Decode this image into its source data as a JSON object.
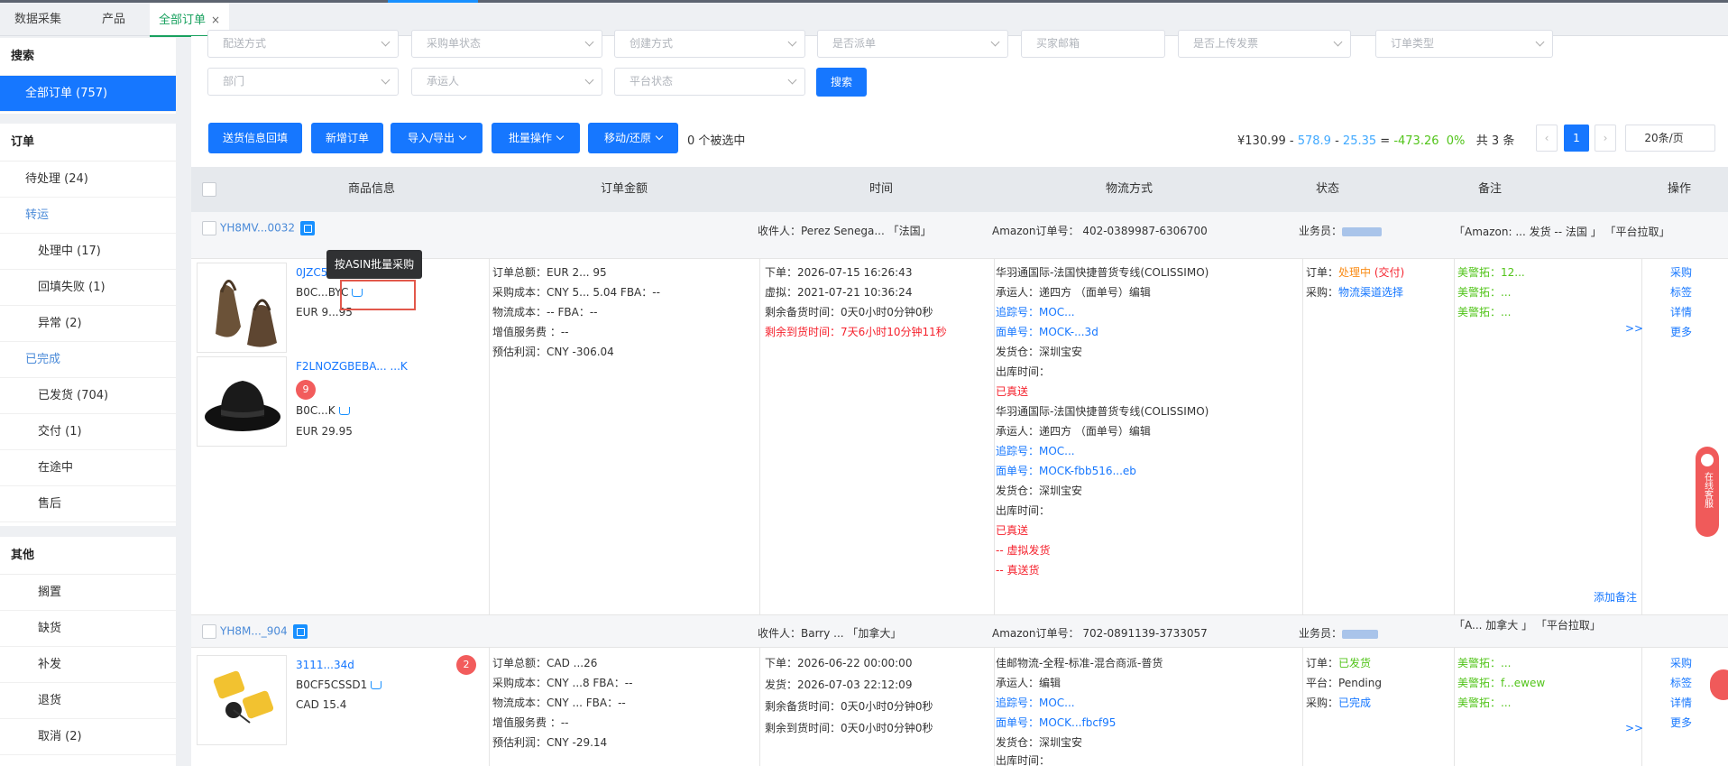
{
  "tabs": [
    "数据采集",
    "产品",
    "全部订单"
  ],
  "sidebar": {
    "search_header": "搜索",
    "all_orders": "全部订单 (757)",
    "order_header": "订单",
    "order_items": [
      "待处理 (24)",
      "转运",
      "处理中 (17)",
      "回填失败 (1)",
      "异常 (2)",
      "已完成",
      "已发货 (704)",
      "交付 (1)",
      "在途中",
      "售后"
    ],
    "other_header": "其他",
    "other_items": [
      "搁置",
      "缺货",
      "补发",
      "退货",
      "取消 (2)"
    ]
  },
  "filters": {
    "row1": [
      "配送方式",
      "采购单状态",
      "创建方式",
      "是否派单",
      "买家邮箱",
      "是否上传发票",
      "订单类型"
    ],
    "row2": [
      "部门",
      "承运人",
      "平台状态"
    ],
    "search_btn": "搜索"
  },
  "toolbar": {
    "buttons": [
      "送货信息回填",
      "新增订单",
      "导入/导出",
      "批量操作",
      "移动/还原"
    ],
    "selected": "0 个被选中"
  },
  "summary": {
    "total": "¥130.99",
    "minus1": "578.9",
    "minus2": "25.35",
    "result": "-473.26",
    "pct": "0%",
    "count": "共 3 条"
  },
  "pagination": {
    "page": "1",
    "size": "20条/页"
  },
  "columns": [
    "商品信息",
    "订单金额",
    "时间",
    "物流方式",
    "状态",
    "备注",
    "操作"
  ],
  "orders": [
    {
      "no": "YH8MV...0032",
      "recipient": "收件人：Perez Senega... 「法国」",
      "amazon_no": "Amazon订单号： 402-0389987-6306700",
      "salesman": "业务员：",
      "remark": "「Amazon: ... 发货 -- 法国 」 「平台拉取」",
      "products": [
        {
          "title": "0JZC5...",
          "sku": "B0C...BYC",
          "price": "EUR 9...95"
        },
        {
          "title": "F2LNOZGBEBA... ...K",
          "sku": "B0C...K",
          "price": "EUR 29.95",
          "badge": "9"
        }
      ],
      "amount": [
        "订单总额：EUR 2... 95",
        "采购成本：CNY 5... 5.04   FBA：--",
        "物流成本：--   FBA：--",
        "增值服务费 ：--",
        "预估利润：CNY -306.04"
      ],
      "times": [
        "下单：2026-07-15 16:26:43",
        "虚拟：2021-07-21 10:36:24",
        "剩余备货时间：0天0小时0分钟0秒",
        "剩余到货时间：7天6小时10分钟11秒"
      ],
      "logistics": [
        "华羽通国际-法国快捷普货专线(COLISSIMO)",
        "承运人：递四方 （面单号）编辑",
        "追踪号：MOC...",
        "面单号：MOCK-...3d",
        "发货仓：深圳宝安",
        "出库时间：",
        "已真送",
        "华羽通国际-法国快捷普货专线(COLISSIMO)",
        "承运人：递四方 （面单号）编辑",
        "追踪号：MOC...",
        "面单号：MOCK-fbb516...eb",
        "发货仓：深圳宝安",
        "出库时间：",
        "已真送",
        "-- 虚拟发货",
        "-- 真送货"
      ],
      "status": {
        "order_label": "订单：",
        "order_val": "处理中",
        "order_extra": "(交付)",
        "purchase_label": "采购：",
        "purchase_val": "物流渠道选择"
      },
      "remarks": [
        "美警拓：12...",
        "美警拓：...",
        "美警拓：..."
      ],
      "ops": [
        "采购",
        "标签",
        "详情",
        "更多"
      ],
      "add_note": "添加备注"
    },
    {
      "no": "YH8M..._904",
      "recipient": "收件人：Barry ... 「加拿大」",
      "amazon_no": "Amazon订单号： 702-0891139-3733057",
      "salesman": "业务员：",
      "remark": "「A... 加拿大 」 「平台拉取」",
      "products": [
        {
          "title": "3111...34d",
          "sku": "B0CF5CSSD1",
          "price": "CAD 15.4",
          "badge": "2"
        }
      ],
      "amount": [
        "订单总额：CAD ...26",
        "采购成本：CNY ...8   FBA：--",
        "物流成本：CNY ...   FBA：--",
        "增值服务费 ：--",
        "预估利润：CNY -29.14"
      ],
      "times": [
        "下单：2026-06-22 00:00:00",
        "发货：2026-07-03 22:12:09",
        "剩余备货时间：0天0小时0分钟0秒",
        "剩余到货时间：0天0小时0分钟0秒"
      ],
      "logistics": [
        "佳邮物流-全程-标准-混合商派-普货",
        "承运人：编辑",
        "追踪号：MOC...",
        "面单号：MOCK...fbcf95",
        "发货仓：深圳宝安",
        "出库时间："
      ],
      "status": {
        "order_label": "订单：",
        "order_val": "已发货",
        "platform_label": "平台：",
        "platform_val": "Pending",
        "purchase_label": "采购：",
        "purchase_val": "已完成"
      },
      "remarks": [
        "美警拓：...",
        "美警拓：f...ewew",
        "美警拓：..."
      ],
      "ops": [
        "采购",
        "标签",
        "详情",
        "更多"
      ]
    }
  ],
  "tooltip": "按ASIN批量采购",
  "more": ">>",
  "chat": "在线客服"
}
